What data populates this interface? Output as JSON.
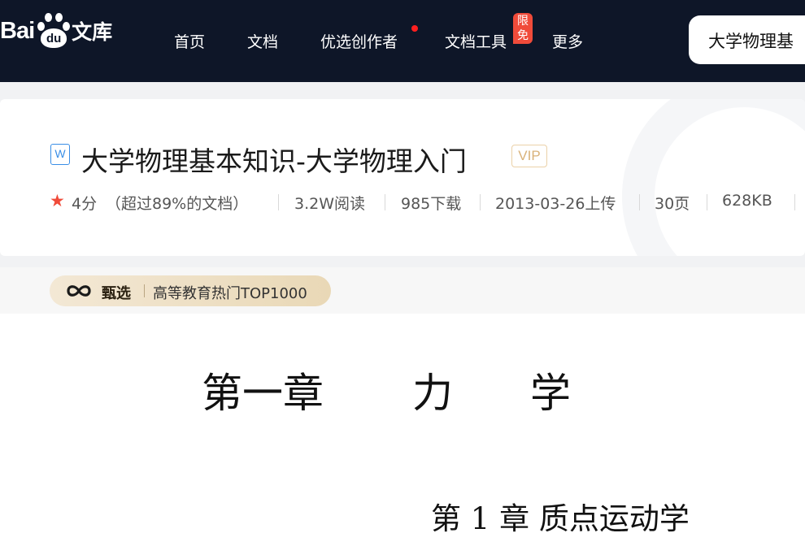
{
  "logo": {
    "bai": "Bai",
    "du": "du",
    "wenku": "文库"
  },
  "nav": {
    "items": [
      "首页",
      "文档",
      "优选创作者",
      "文档工具",
      "更多"
    ],
    "free_badge": "限免"
  },
  "search": {
    "value": "大学物理基"
  },
  "document": {
    "icon_letter": "W",
    "title": "大学物理基本知识-大学物理入门",
    "vip_label": "VIP",
    "rating": "4分",
    "rating_note": "（超过89%的文档）",
    "reads": "3.2W阅读",
    "downloads": "985下载",
    "upload_date": "2013-03-26上传",
    "pages": "30页",
    "size": "628KB"
  },
  "selection": {
    "label": "甄选",
    "tag": "高等教育热门TOP1000"
  },
  "content": {
    "chapter_part1": "第一章",
    "chapter_part2": "力",
    "chapter_part3": "学",
    "section": "第 1 章  质点运动学"
  },
  "colors": {
    "topbar_bg": "#0e1628",
    "accent_red": "#f04b3a",
    "vip_gold": "#d9b27a",
    "doc_icon_blue": "#3a8ee6"
  }
}
